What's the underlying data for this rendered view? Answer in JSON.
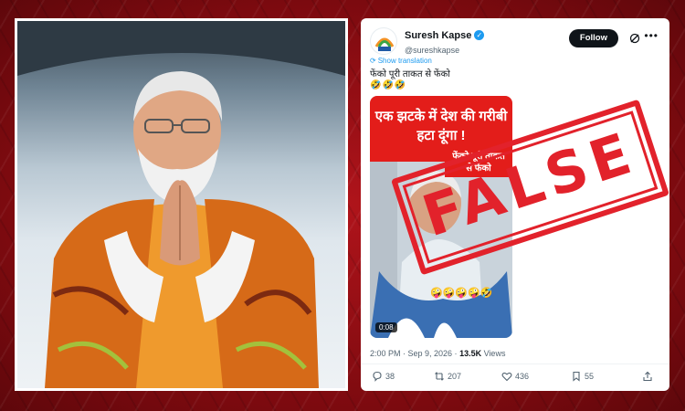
{
  "tweet": {
    "author_name": "Suresh Kapse",
    "author_handle": "@sureshkapse",
    "follow_label": "Follow",
    "show_translation": "Show translation",
    "text": "फेंको पूरी ताकत से फेंको",
    "emoji_line": "🤣🤣🤣",
    "video": {
      "banner_text": "एक झटके में देश की गरीबी हटा दूंगा !",
      "caption": "फेंको पूरी ताकत से फेंको",
      "emojis": "🤪🤪🤪🤪🤣",
      "duration": "0:08"
    },
    "timestamp": "2:00 PM · Sep 9, 2026 · ",
    "views_count": "13.5K",
    "views_label": " Views",
    "replies": "38",
    "reposts": "207",
    "likes": "436",
    "bookmarks": "55"
  },
  "stamp": {
    "label": "FALSE"
  },
  "colors": {
    "background_red": "#9b1016",
    "stamp_red": "#e2222b",
    "banner_red": "#e31d1a",
    "link_blue": "#1d9bf0"
  },
  "icons": [
    "verified-badge-icon",
    "grok-icon",
    "more-icon",
    "translate-icon",
    "reply-icon",
    "repost-icon",
    "like-icon",
    "bookmark-icon",
    "share-icon"
  ]
}
